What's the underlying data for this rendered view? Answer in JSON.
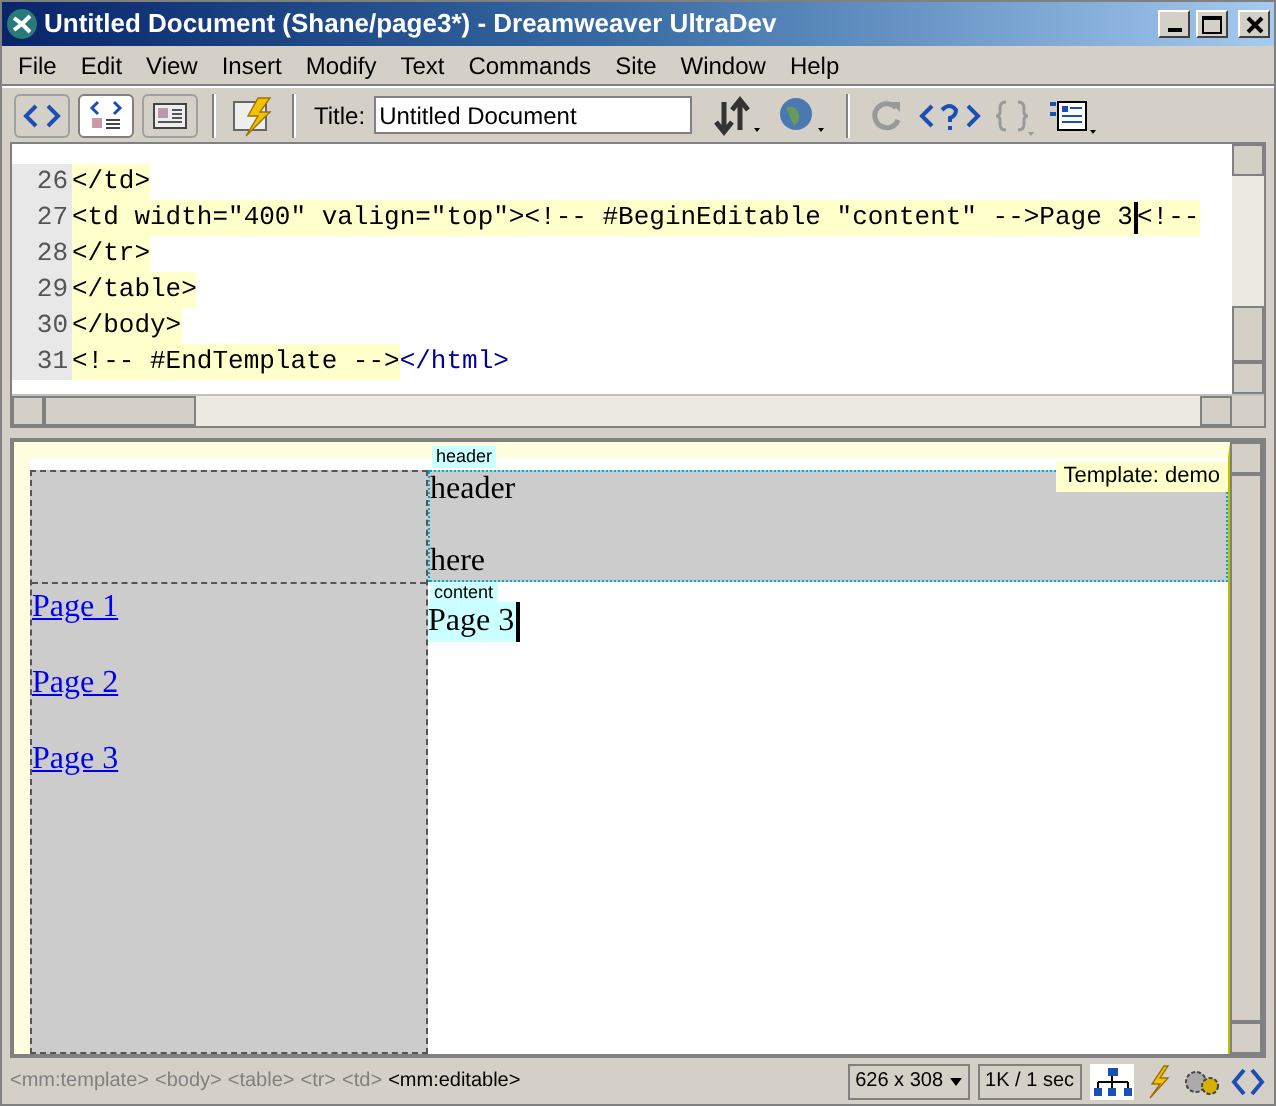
{
  "window": {
    "title": "Untitled Document (Shane/page3*) - Dreamweaver UltraDev"
  },
  "menu": [
    "File",
    "Edit",
    "View",
    "Insert",
    "Modify",
    "Text",
    "Commands",
    "Site",
    "Window",
    "Help"
  ],
  "toolbar": {
    "views": [
      {
        "kind": "code",
        "selected": false
      },
      {
        "kind": "split",
        "selected": true
      },
      {
        "kind": "design",
        "selected": false
      }
    ],
    "title_label": "Title:",
    "title_value": "Untitled Document"
  },
  "code": {
    "lines": [
      {
        "number": "26",
        "segments": [
          {
            "text": "</td>",
            "kind": "locked"
          }
        ]
      },
      {
        "number": "27",
        "segments": [
          {
            "text": "<td width=\"400\" valign=\"top\"><!-- #BeginEditable \"content\" -->Page 3",
            "kind": "locked"
          },
          {
            "text": "<!--",
            "kind": "locked"
          }
        ],
        "cursor": true
      },
      {
        "number": "28",
        "segments": [
          {
            "text": "</tr>",
            "kind": "locked"
          }
        ]
      },
      {
        "number": "29",
        "segments": [
          {
            "text": "</table>",
            "kind": "locked"
          }
        ]
      },
      {
        "number": "30",
        "segments": [
          {
            "text": "</body>",
            "kind": "locked"
          }
        ]
      },
      {
        "number": "31",
        "segments": [
          {
            "text": "<!-- #EndTemplate -->",
            "kind": "locked"
          },
          {
            "text": "</html>",
            "kind": "tag"
          }
        ]
      }
    ]
  },
  "design": {
    "template_label": "Template: demo",
    "header_region": {
      "label": "header",
      "lines": [
        "header",
        "here"
      ]
    },
    "links": [
      "Page 1",
      "Page 2",
      "Page 3"
    ],
    "content_region": {
      "label": "content",
      "text": "Page 3"
    }
  },
  "status_bar": {
    "tags": [
      {
        "text": "<mm:template>",
        "selected": false
      },
      {
        "text": "<body>",
        "selected": false
      },
      {
        "text": "<table>",
        "selected": false
      },
      {
        "text": "<tr>",
        "selected": false
      },
      {
        "text": "<td>",
        "selected": false
      },
      {
        "text": "<mm:editable>",
        "selected": true
      }
    ],
    "size": "626 x 308",
    "speed": "1K / 1 sec"
  }
}
